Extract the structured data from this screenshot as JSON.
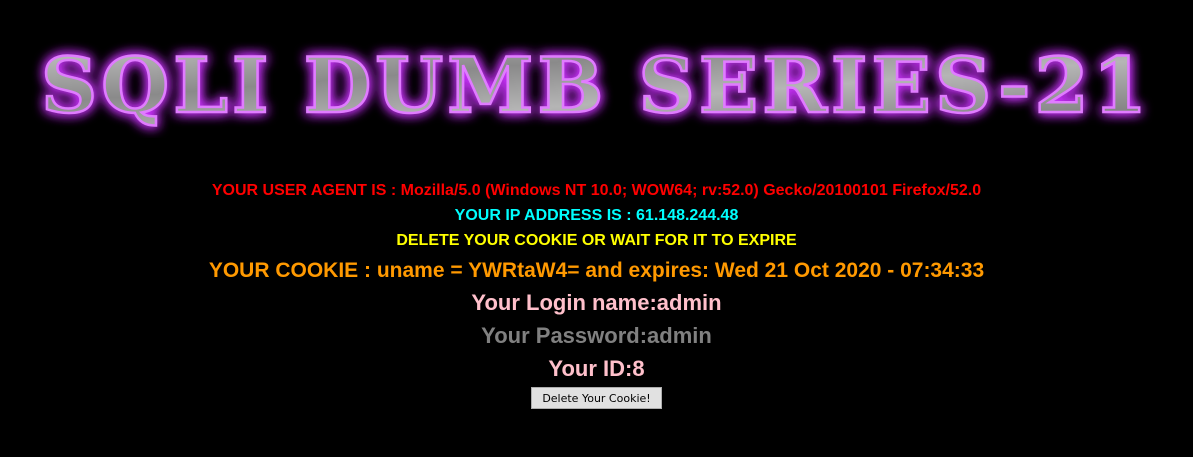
{
  "banner": {
    "title": "SQLI DUMB SERIES-21",
    "glow_color": "#cc33ff",
    "fill_color": "#9a9a9a"
  },
  "info": {
    "user_agent": "YOUR USER AGENT IS : Mozilla/5.0 (Windows NT 10.0; WOW64; rv:52.0) Gecko/20100101 Firefox/52.0",
    "ip_address": "YOUR IP ADDRESS IS : 61.148.244.48",
    "delete_notice": "DELETE YOUR COOKIE OR WAIT FOR IT TO EXPIRE",
    "cookie": "YOUR COOKIE : uname = YWRtaW4= and expires: Wed 21 Oct 2020 - 07:34:33",
    "login_name": "Your Login name:admin",
    "password": "Your Password:admin",
    "user_id": "Your ID:8"
  },
  "actions": {
    "delete_cookie_label": "Delete Your Cookie!"
  },
  "colors": {
    "background": "#000000",
    "user_agent": "#ff0000",
    "ip_address": "#00ffff",
    "delete_notice": "#ffff00",
    "cookie": "#ff9900",
    "login": "#ffc0cb",
    "password": "#808080",
    "id": "#ffc0cb"
  }
}
